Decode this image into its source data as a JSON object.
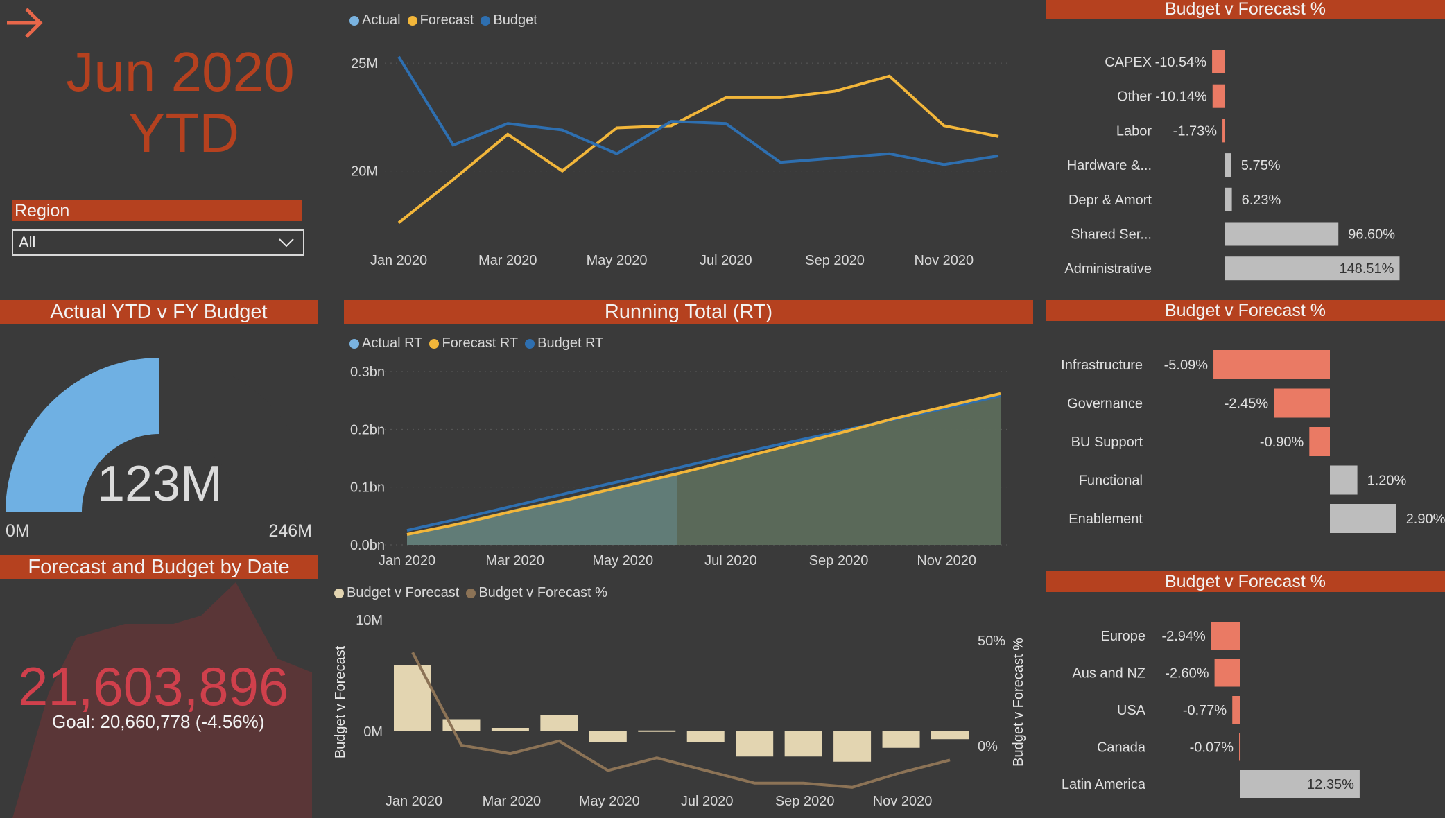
{
  "nav": {
    "back_icon": "arrow-right-icon"
  },
  "period": {
    "line1": "Jun 2020",
    "line2": "YTD"
  },
  "region_filter": {
    "label": "Region",
    "value": "All"
  },
  "trend_chart": {
    "legend": [
      "Actual",
      "Forecast",
      "Budget"
    ],
    "colors": {
      "actual": "#7ab3e0",
      "forecast": "#f2b63a",
      "budget": "#2e6fb0"
    },
    "y_ticks": [
      "25M",
      "20M"
    ],
    "x_ticks": [
      "Jan 2020",
      "Mar 2020",
      "May 2020",
      "Jul 2020",
      "Sep 2020",
      "Nov 2020"
    ]
  },
  "gauge": {
    "title": "Actual YTD v FY Budget",
    "value_label": "123M",
    "min_label": "0M",
    "max_label": "246M",
    "fill_fraction": 0.5,
    "color": "#6fb0e3"
  },
  "kpi": {
    "title": "Forecast and Budget by Date",
    "value": "21,603,896",
    "goal": "Goal: 20,660,778 (-4.56%)",
    "color": "#d0404c"
  },
  "running_total": {
    "title": "Running Total (RT)",
    "legend": [
      "Actual RT",
      "Forecast RT",
      "Budget RT"
    ],
    "y_ticks": [
      "0.3bn",
      "0.2bn",
      "0.1bn",
      "0.0bn"
    ],
    "x_ticks": [
      "Jan 2020",
      "Mar 2020",
      "May 2020",
      "Jul 2020",
      "Sep 2020",
      "Nov 2020"
    ]
  },
  "variance_chart": {
    "legend": [
      "Budget v Forecast",
      "Budget v Forecast %"
    ],
    "y_left_ticks": [
      "10M",
      "0M"
    ],
    "y_right_ticks": [
      "50%",
      "0%"
    ],
    "y_left_label": "Budget v Forecast",
    "y_right_label": "Budget v Forecast %",
    "x_ticks": [
      "Jan 2020",
      "Mar 2020",
      "May 2020",
      "Jul 2020",
      "Sep 2020",
      "Nov 2020"
    ]
  },
  "bvf_category": {
    "title": "Budget v Forecast %",
    "items": [
      {
        "label": "CAPEX",
        "value": "-10.54%"
      },
      {
        "label": "Other",
        "value": "-10.14%"
      },
      {
        "label": "Labor",
        "value": "-1.73%"
      },
      {
        "label": "Hardware &...",
        "value": "5.75%"
      },
      {
        "label": "Depr & Amort",
        "value": "6.23%"
      },
      {
        "label": "Shared Ser...",
        "value": "96.60%"
      },
      {
        "label": "Administrative",
        "value": "148.51%"
      }
    ]
  },
  "bvf_function": {
    "title": "Budget v Forecast %",
    "items": [
      {
        "label": "Infrastructure",
        "value": "-5.09%"
      },
      {
        "label": "Governance",
        "value": "-2.45%"
      },
      {
        "label": "BU Support",
        "value": "-0.90%"
      },
      {
        "label": "Functional",
        "value": "1.20%"
      },
      {
        "label": "Enablement",
        "value": "2.90%"
      }
    ]
  },
  "bvf_region": {
    "title": "Budget v Forecast %",
    "items": [
      {
        "label": "Europe",
        "value": "-2.94%"
      },
      {
        "label": "Aus and NZ",
        "value": "-2.60%"
      },
      {
        "label": "USA",
        "value": "-0.77%"
      },
      {
        "label": "Canada",
        "value": "-0.07%"
      },
      {
        "label": "Latin America",
        "value": "12.35%"
      }
    ]
  },
  "chart_data": [
    {
      "type": "line",
      "title": "",
      "x": [
        "Jan 2020",
        "Feb 2020",
        "Mar 2020",
        "Apr 2020",
        "May 2020",
        "Jun 2020",
        "Jul 2020",
        "Aug 2020",
        "Sep 2020",
        "Oct 2020",
        "Nov 2020",
        "Dec 2020"
      ],
      "series": [
        {
          "name": "Forecast",
          "values": [
            17.6,
            19.6,
            21.7,
            20.0,
            22.0,
            22.1,
            23.4,
            23.4,
            23.7,
            24.4,
            22.1,
            21.6
          ]
        },
        {
          "name": "Budget",
          "values": [
            25.3,
            21.2,
            22.2,
            21.9,
            20.8,
            22.3,
            22.2,
            20.4,
            20.6,
            20.8,
            20.3,
            20.7
          ]
        }
      ],
      "ylabel": "",
      "ylim": [
        17,
        26
      ],
      "units": "M"
    },
    {
      "type": "area",
      "title": "Running Total (RT)",
      "x": [
        "Jan 2020",
        "Feb 2020",
        "Mar 2020",
        "Apr 2020",
        "May 2020",
        "Jun 2020",
        "Jul 2020",
        "Aug 2020",
        "Sep 2020",
        "Oct 2020",
        "Nov 2020",
        "Dec 2020"
      ],
      "series": [
        {
          "name": "Actual RT",
          "values": [
            0.018,
            0.04,
            0.062,
            0.082,
            0.104,
            0.123,
            null,
            null,
            null,
            null,
            null,
            null
          ]
        },
        {
          "name": "Forecast RT",
          "values": [
            0.018,
            0.037,
            0.059,
            0.079,
            0.101,
            0.123,
            0.146,
            0.17,
            0.193,
            0.218,
            0.24,
            0.262
          ]
        },
        {
          "name": "Budget RT",
          "values": [
            0.025,
            0.046,
            0.068,
            0.09,
            0.111,
            0.133,
            0.155,
            0.176,
            0.196,
            0.217,
            0.237,
            0.258
          ]
        }
      ],
      "ylim": [
        0,
        0.3
      ],
      "units": "bn"
    },
    {
      "type": "bar",
      "title": "",
      "x": [
        "Jan 2020",
        "Feb 2020",
        "Mar 2020",
        "Apr 2020",
        "May 2020",
        "Jun 2020",
        "Jul 2020",
        "Aug 2020",
        "Sep 2020",
        "Oct 2020",
        "Nov 2020",
        "Dec 2020"
      ],
      "series": [
        {
          "name": "Budget v Forecast",
          "values": [
            7.6,
            1.4,
            0.4,
            1.9,
            -1.2,
            0.1,
            -1.2,
            -2.9,
            -2.9,
            -3.5,
            -1.9,
            -0.9
          ]
        },
        {
          "name": "Budget v Forecast %",
          "values": [
            44,
            0,
            -4,
            2,
            -12,
            -6,
            -12,
            -18,
            -18,
            -20,
            -13,
            -7
          ]
        }
      ],
      "ylabel": "Budget v Forecast",
      "y2label": "Budget v Forecast %"
    },
    {
      "type": "bar",
      "title": "Budget v Forecast %",
      "categories": [
        "CAPEX",
        "Other",
        "Labor",
        "Hardware &...",
        "Depr & Amort",
        "Shared Ser...",
        "Administrative"
      ],
      "values": [
        -10.54,
        -10.14,
        -1.73,
        5.75,
        6.23,
        96.6,
        148.51
      ]
    },
    {
      "type": "bar",
      "title": "Budget v Forecast %",
      "categories": [
        "Infrastructure",
        "Governance",
        "BU Support",
        "Functional",
        "Enablement"
      ],
      "values": [
        -5.09,
        -2.45,
        -0.9,
        1.2,
        2.9
      ]
    },
    {
      "type": "bar",
      "title": "Budget v Forecast %",
      "categories": [
        "Europe",
        "Aus and NZ",
        "USA",
        "Canada",
        "Latin America"
      ],
      "values": [
        -2.94,
        -2.6,
        -0.77,
        -0.07,
        12.35
      ]
    }
  ]
}
